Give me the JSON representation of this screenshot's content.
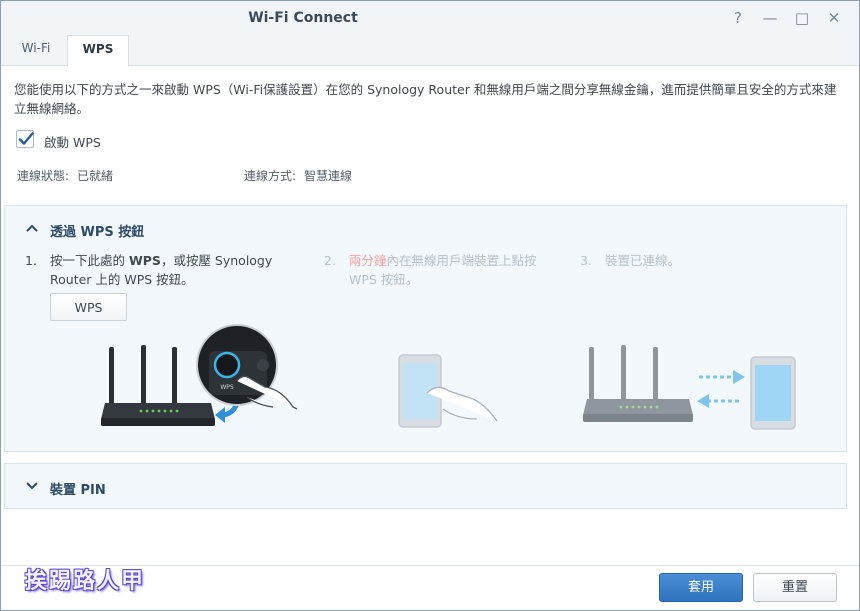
{
  "window": {
    "title": "Wi-Fi Connect",
    "controls": {
      "help": "?",
      "minimize": "—",
      "maximize": "□",
      "close": "✕"
    }
  },
  "tabs": [
    {
      "label": "Wi-Fi",
      "active": false
    },
    {
      "label": "WPS",
      "active": true
    }
  ],
  "description": "您能使用以下的方式之一來啟動 WPS（Wi-Fi保護設置）在您的 Synology Router 和無線用戶端之間分享無線金鑰，進而提供簡單且安全的方式來建立無線網絡。",
  "enable_wps": {
    "label": "啟動 WPS",
    "checked": true
  },
  "status": {
    "state_label": "連線狀態:",
    "state_value": "已就緒",
    "method_label": "連線方式:",
    "method_value": "智慧連線"
  },
  "push_button_panel": {
    "title": "透過 WPS 按鈕",
    "expanded": true,
    "steps": [
      {
        "num": "1.",
        "text_before": "按一下此處的 ",
        "text_bold": "WPS",
        "text_after": "，或按壓 Synology Router 上的 WPS 按鈕。"
      },
      {
        "num": "2.",
        "text_red": "兩分鐘",
        "text_after": "內在無線用戶端裝置上點按 WPS 按鈕。"
      },
      {
        "num": "3.",
        "text": "裝置已連線。"
      }
    ],
    "wps_button_label": "WPS",
    "router_button_text": "WPS"
  },
  "pin_panel": {
    "title": "裝置 PIN",
    "expanded": false
  },
  "footer": {
    "apply_label": "套用",
    "reset_label": "重置"
  },
  "watermark": "挨踢路人甲",
  "colors": {
    "accent": "#2f72bd",
    "panel_bg": "#f3f8fc",
    "arrow_blue": "#2f8fd8",
    "step_highlight_red": "#e2504a"
  }
}
